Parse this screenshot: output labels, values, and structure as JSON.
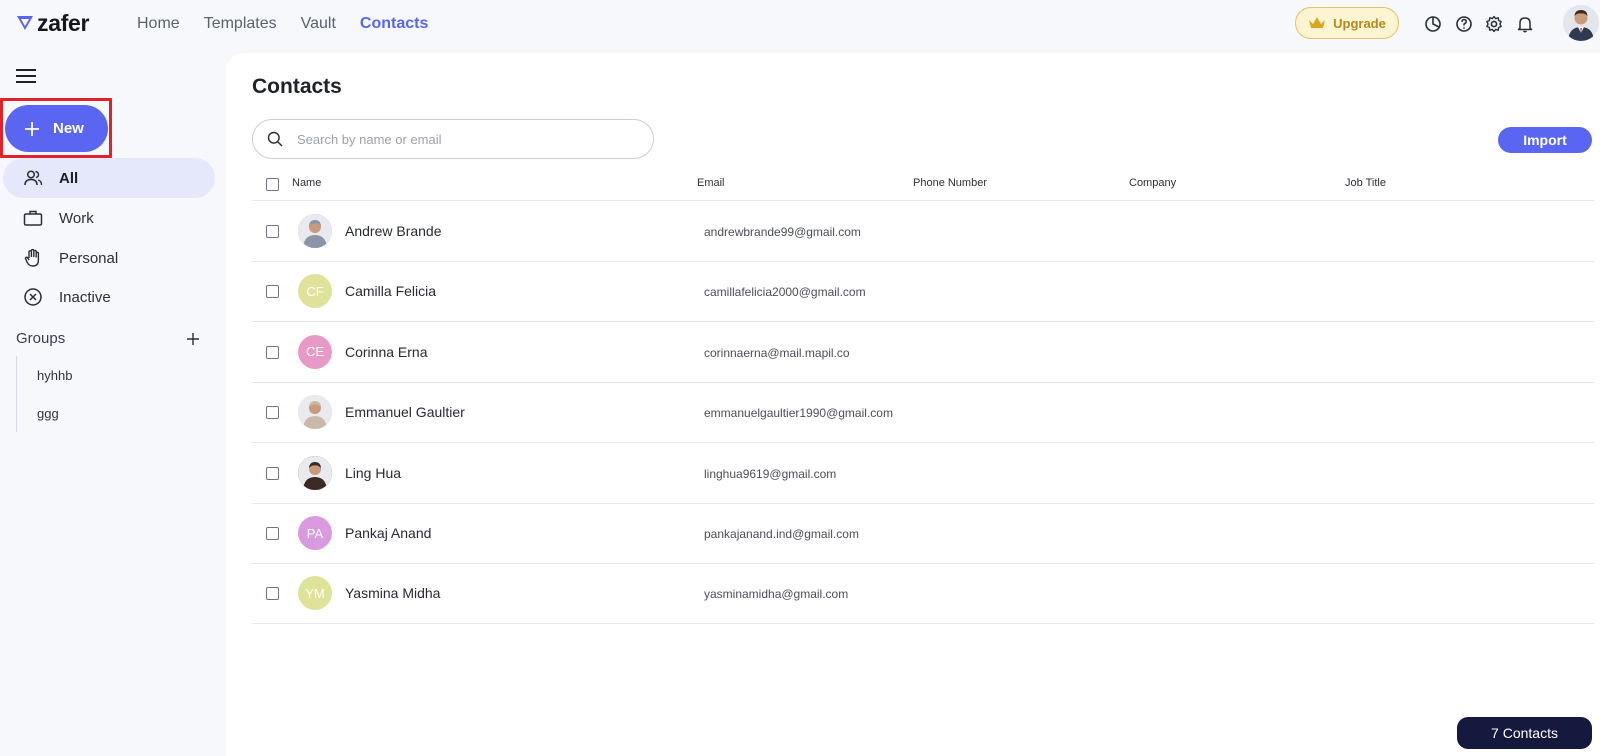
{
  "app": {
    "name": "zafer"
  },
  "nav": {
    "items": [
      {
        "label": "Home"
      },
      {
        "label": "Templates"
      },
      {
        "label": "Vault"
      },
      {
        "label": "Contacts",
        "active": true
      }
    ]
  },
  "header": {
    "upgrade_label": "Upgrade",
    "icons": [
      "pie-chart-icon",
      "help-icon",
      "settings-icon",
      "bell-icon"
    ]
  },
  "sidebar": {
    "new_label": "New",
    "items": [
      {
        "label": "All",
        "icon": "people-icon",
        "active": true
      },
      {
        "label": "Work",
        "icon": "briefcase-icon"
      },
      {
        "label": "Personal",
        "icon": "hand-icon"
      },
      {
        "label": "Inactive",
        "icon": "x-circle-icon"
      }
    ],
    "groups_title": "Groups",
    "groups": [
      {
        "label": "hyhhb"
      },
      {
        "label": "ggg"
      }
    ]
  },
  "main": {
    "title": "Contacts",
    "search_placeholder": "Search by name or email",
    "import_label": "Import",
    "columns": [
      "Name",
      "Email",
      "Phone Number",
      "Company",
      "Job Title"
    ],
    "contacts": [
      {
        "name": "Andrew Brande",
        "email": "andrewbrande99@gmail.com",
        "initials": "",
        "photo": true,
        "color": "#8a95a8"
      },
      {
        "name": "Camilla Felicia",
        "email": "camillafelicia2000@gmail.com",
        "initials": "CF",
        "photo": false,
        "color": "#dfe39a"
      },
      {
        "name": "Corinna Erna",
        "email": "corinnaerna@mail.mapil.co",
        "initials": "CE",
        "photo": false,
        "color": "#e89ac6"
      },
      {
        "name": "Emmanuel Gaultier",
        "email": "emmanuelgaultier1990@gmail.com",
        "initials": "",
        "photo": true,
        "color": "#c9b9aa"
      },
      {
        "name": "Ling Hua",
        "email": "linghua9619@gmail.com",
        "initials": "",
        "photo": true,
        "color": "#3b2b24"
      },
      {
        "name": "Pankaj Anand",
        "email": "pankajanand.ind@gmail.com",
        "initials": "PA",
        "photo": false,
        "color": "#d99ae0"
      },
      {
        "name": "Yasmina Midha",
        "email": "yasminamidha@gmail.com",
        "initials": "YM",
        "photo": false,
        "color": "#dfe39a"
      }
    ],
    "count_label": "7 Contacts"
  },
  "colors": {
    "accent": "#5a66f2",
    "highlight": "#e0232a",
    "count_pill": "#15193d"
  }
}
